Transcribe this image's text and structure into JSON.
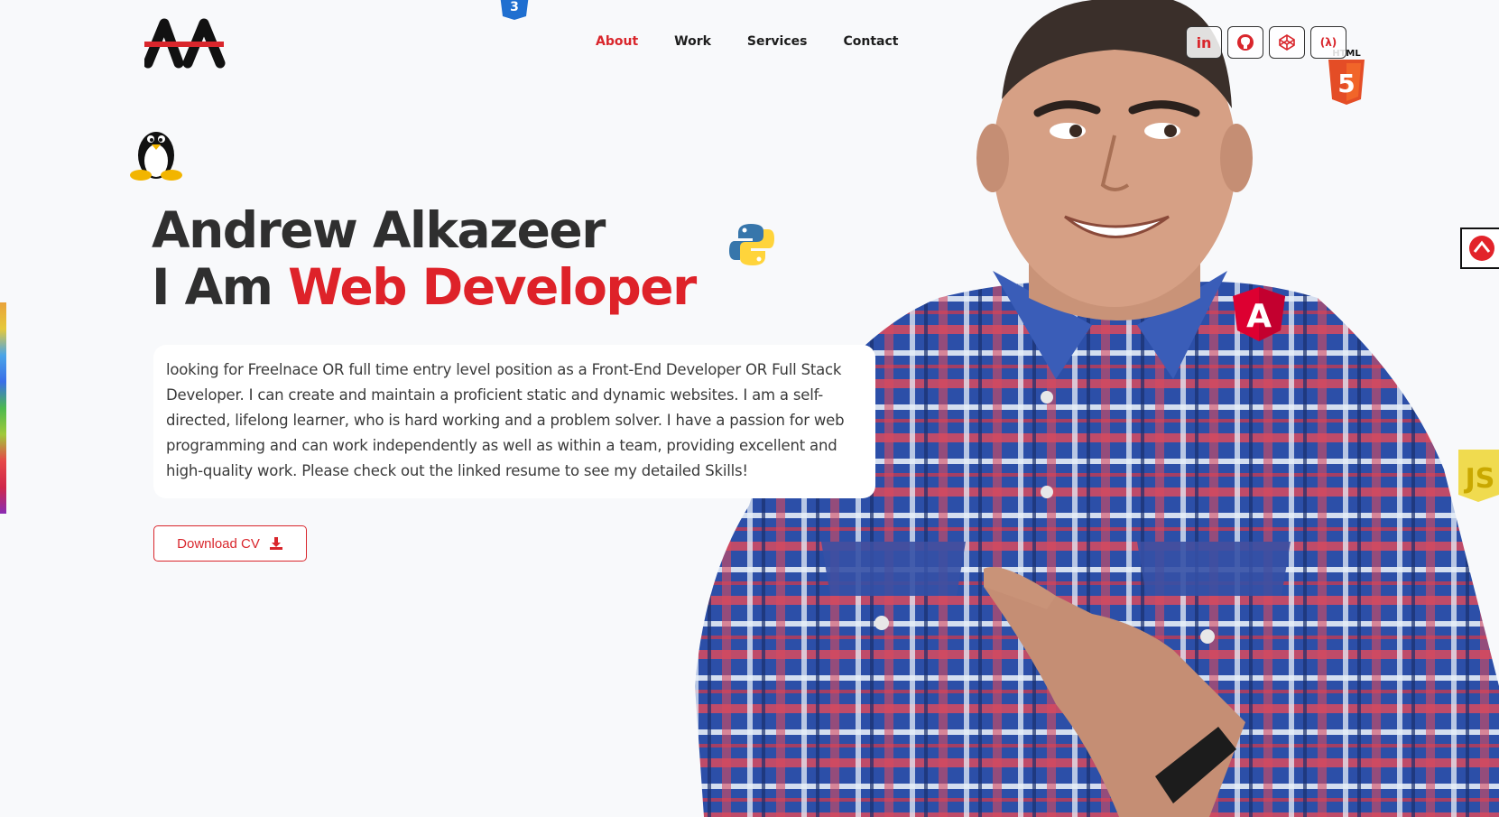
{
  "brand": {
    "logo_text": "AA"
  },
  "nav": {
    "items": [
      {
        "label": "About",
        "active": true
      },
      {
        "label": "Work",
        "active": false
      },
      {
        "label": "Services",
        "active": false
      },
      {
        "label": "Contact",
        "active": false
      }
    ]
  },
  "socials": [
    {
      "icon": "linkedin-icon",
      "glyph": "in"
    },
    {
      "icon": "github-icon"
    },
    {
      "icon": "codepen-icon"
    },
    {
      "icon": "freecodecamp-icon",
      "glyph": "(λ)"
    }
  ],
  "hero": {
    "name": "Andrew Alkazeer",
    "role_prefix": "I Am ",
    "role_accent": "Web Developer",
    "bio": "looking for Freelnace OR full time entry level position as a Front-End Developer OR Full Stack Developer. I can create and maintain a proficient static and dynamic websites. I am a self-directed, lifelong learner, who is hard working and a problem solver. I have a passion for web programming and can work independently as well as within a team, providing excellent and high-quality work. Please check out the linked resume to see my detailed Skills!",
    "cv_button": "Download CV"
  },
  "floating_icons": {
    "html_label": "HTML",
    "html_glyph": "5",
    "js_label": "JS",
    "angular_glyph": "A",
    "css_glyph": "3"
  },
  "colors": {
    "accent": "#d9262c",
    "background": "#f8f9fb",
    "text": "#2f2f2f"
  }
}
